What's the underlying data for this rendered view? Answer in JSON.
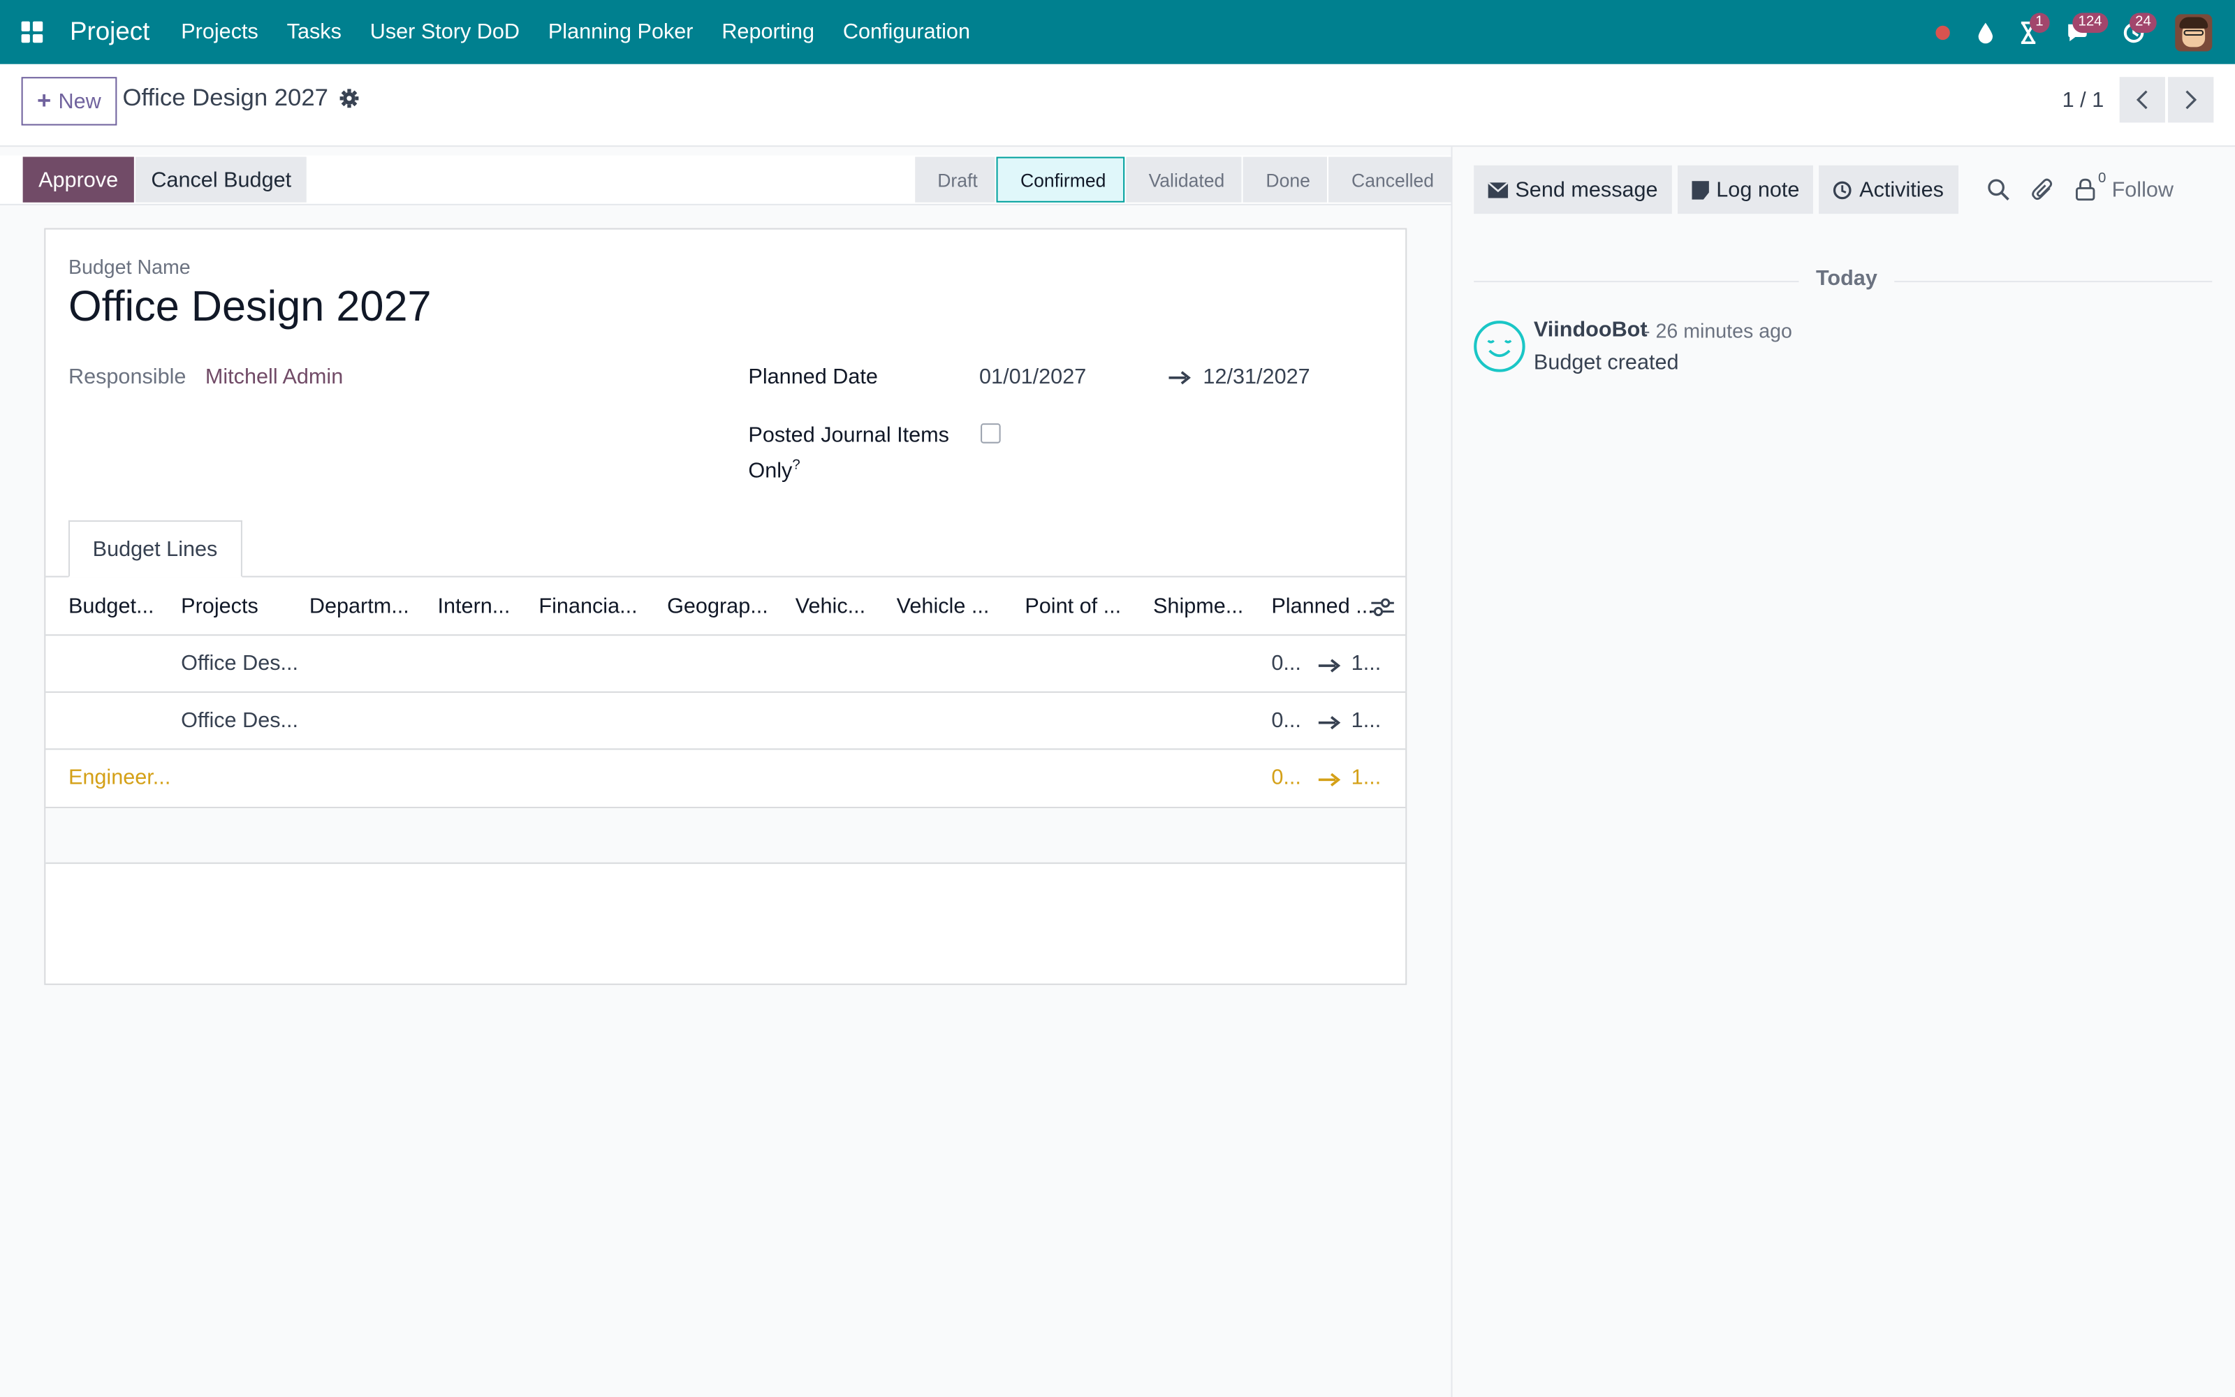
{
  "navbar": {
    "brand": "Project",
    "menu": [
      "Projects",
      "Tasks",
      "User Story DoD",
      "Planning Poker",
      "Reporting",
      "Configuration"
    ],
    "badges": {
      "activities": "1",
      "messages": "124",
      "updates": "24"
    }
  },
  "control": {
    "new_label": "New",
    "breadcrumb": "Office Design 2027",
    "pager": "1 / 1"
  },
  "status": {
    "approve_label": "Approve",
    "cancel_label": "Cancel Budget",
    "stages": [
      "Draft",
      "Confirmed",
      "Validated",
      "Done",
      "Cancelled"
    ],
    "active_stage": "Confirmed"
  },
  "form": {
    "budget_name_label": "Budget Name",
    "budget_name": "Office Design 2027",
    "responsible_label": "Responsible",
    "responsible": "Mitchell Admin",
    "planned_date_label": "Planned Date",
    "date_from": "01/01/2027",
    "date_to": "12/31/2027",
    "posted_label": "Posted Journal Items Only",
    "posted_help": "?",
    "tab_label": "Budget Lines"
  },
  "table": {
    "columns": [
      "Budget...",
      "Projects",
      "Departm...",
      "Intern...",
      "Financia...",
      "Geograp...",
      "Vehic...",
      "Vehicle ...",
      "Point of ...",
      "Shipme...",
      "Planned ..."
    ],
    "rows": [
      {
        "budget": "",
        "project": "Office Des...",
        "from": "0...",
        "to": "1..."
      },
      {
        "budget": "",
        "project": "Office Des...",
        "from": "0...",
        "to": "1..."
      },
      {
        "budget": "Engineer...",
        "project": "",
        "from": "0...",
        "to": "1..."
      }
    ]
  },
  "chatter": {
    "send_label": "Send message",
    "log_label": "Log note",
    "activities_label": "Activities",
    "followers_count": "0",
    "follow_label": "Follow",
    "today_label": "Today",
    "author": "ViindooBot",
    "time": "- 26 minutes ago",
    "body": "Budget created"
  },
  "colors": {
    "navbar": "#00808f",
    "primary": "#714b67",
    "section": "#d4a017"
  }
}
